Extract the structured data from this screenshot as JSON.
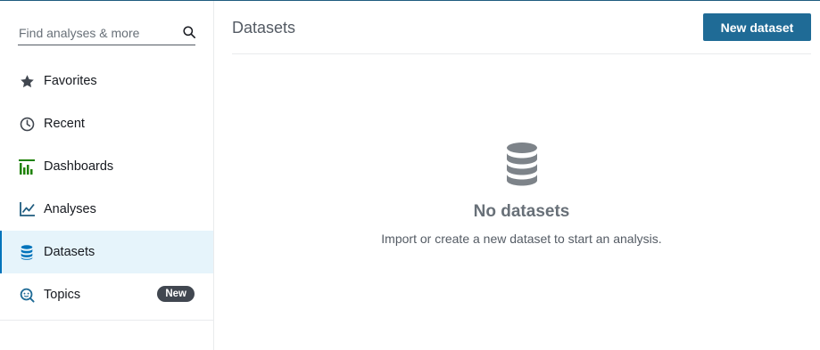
{
  "search": {
    "placeholder": "Find analyses & more",
    "icon": "search-icon"
  },
  "sidebar": {
    "items": [
      {
        "label": "Favorites",
        "icon": "star-icon"
      },
      {
        "label": "Recent",
        "icon": "clock-icon"
      },
      {
        "label": "Dashboards",
        "icon": "dashboard-icon",
        "icon_color": "#1d8102"
      },
      {
        "label": "Analyses",
        "icon": "line-chart-icon",
        "icon_color": "#1f5c7f"
      },
      {
        "label": "Datasets",
        "icon": "database-icon",
        "icon_color": "#0073bb",
        "active": true
      },
      {
        "label": "Topics",
        "icon": "topic-search-icon",
        "icon_color": "#1f6b96",
        "badge": "New"
      }
    ]
  },
  "main": {
    "title": "Datasets",
    "new_button": "New dataset",
    "empty": {
      "icon": "database-icon",
      "title": "No datasets",
      "message": "Import or create a new dataset to start an analysis."
    }
  },
  "colors": {
    "accent": "#1f6b96",
    "active_bg": "#e6f4fb",
    "badge_bg": "#414750"
  }
}
